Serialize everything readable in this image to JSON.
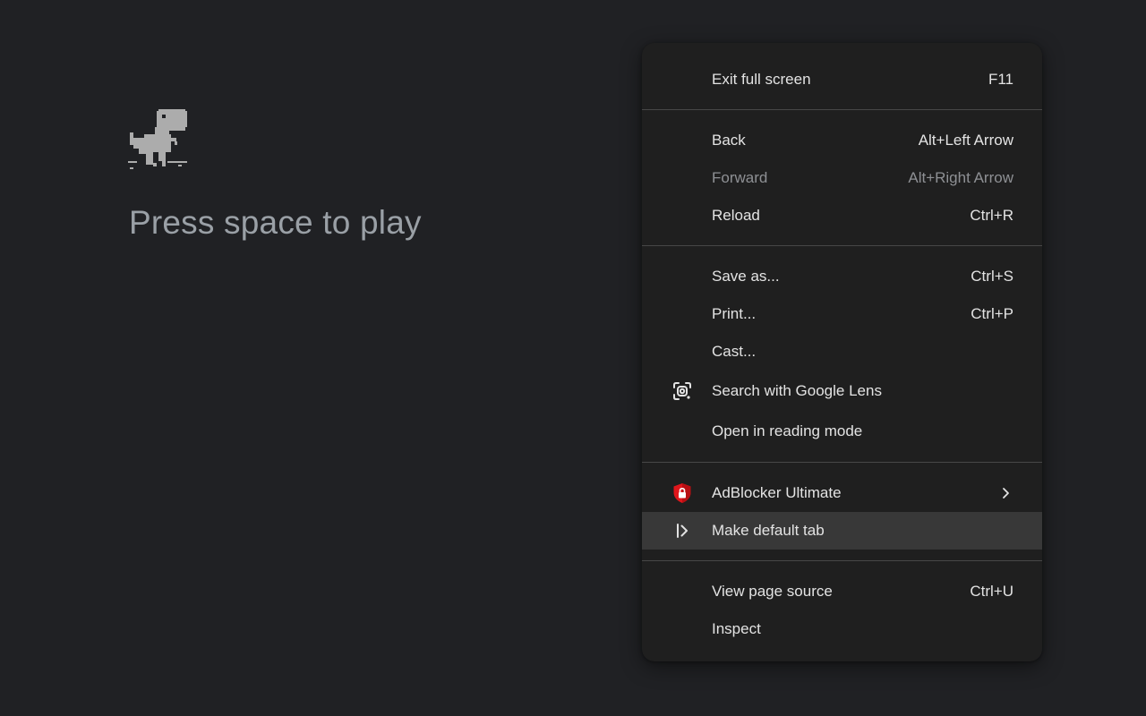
{
  "page": {
    "prompt_text": "Press space to play"
  },
  "menu": {
    "items": [
      {
        "label": "Exit full screen",
        "shortcut": "F11"
      },
      {
        "label": "Back",
        "shortcut": "Alt+Left Arrow"
      },
      {
        "label": "Forward",
        "shortcut": "Alt+Right Arrow",
        "disabled": true
      },
      {
        "label": "Reload",
        "shortcut": "Ctrl+R"
      },
      {
        "label": "Save as...",
        "shortcut": "Ctrl+S"
      },
      {
        "label": "Print...",
        "shortcut": "Ctrl+P"
      },
      {
        "label": "Cast..."
      },
      {
        "label": "Search with Google Lens",
        "icon": "google-lens-icon"
      },
      {
        "label": "Open in reading mode"
      },
      {
        "label": "AdBlocker Ultimate",
        "icon": "adblocker-shield-icon",
        "submenu": true
      },
      {
        "label": "Make default tab",
        "icon": "make-default-tab-icon",
        "highlighted": true
      },
      {
        "label": "View page source",
        "shortcut": "Ctrl+U"
      },
      {
        "label": "Inspect"
      }
    ]
  },
  "colors": {
    "page_background": "#202124",
    "menu_background": "#1f1f1f",
    "menu_hover": "#383838",
    "separator": "#474747",
    "text": "#e3e3e3",
    "text_disabled": "#8e9094",
    "prompt_text": "#9aa0a6",
    "adblocker_red": "#e0161b"
  }
}
